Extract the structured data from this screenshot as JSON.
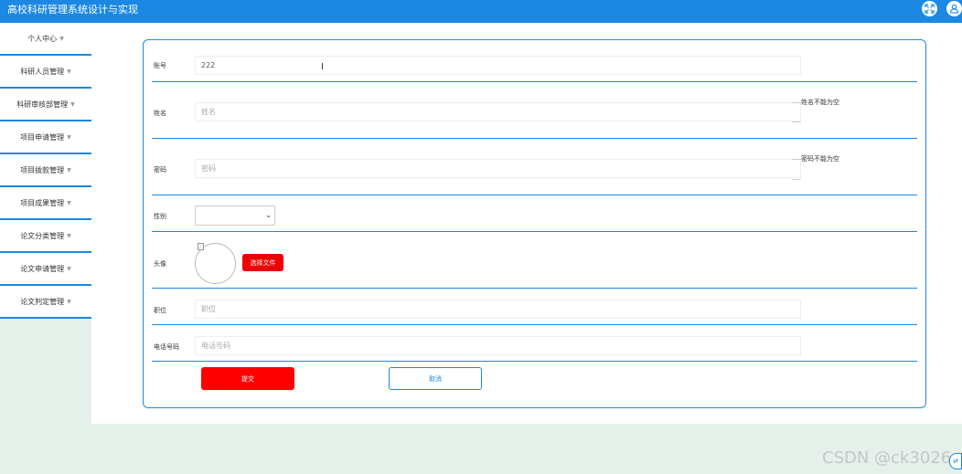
{
  "app": {
    "title": "高校科研管理系统设计与实现"
  },
  "colors": {
    "primary": "#1b88e3",
    "danger": "#ff0000",
    "background": "#e5f0ea"
  },
  "header": {
    "icons": [
      "fullscreen-icon",
      "user-icon"
    ]
  },
  "sidebar": {
    "items": [
      {
        "label": "个人中心"
      },
      {
        "label": "科研人员管理"
      },
      {
        "label": "科研审核部管理"
      },
      {
        "label": "项目申请管理"
      },
      {
        "label": "项目拨款管理"
      },
      {
        "label": "项目成果管理"
      },
      {
        "label": "论文分类管理"
      },
      {
        "label": "论文申请管理"
      },
      {
        "label": "论文判定管理"
      }
    ]
  },
  "form": {
    "account": {
      "label": "账号",
      "value": "222"
    },
    "name": {
      "label": "姓名",
      "placeholder": "姓名",
      "error": "姓名不能为空"
    },
    "password": {
      "label": "密码",
      "placeholder": "密码",
      "error": "密码不能为空"
    },
    "gender": {
      "label": "性别",
      "value": ""
    },
    "avatar": {
      "label": "头像",
      "button": "选择文件"
    },
    "position": {
      "label": "职位",
      "placeholder": "职位"
    },
    "phone": {
      "label": "电话号码",
      "placeholder": "电话号码"
    },
    "submit": "提交",
    "cancel": "取消"
  },
  "watermark": "CSDN @ck3026"
}
